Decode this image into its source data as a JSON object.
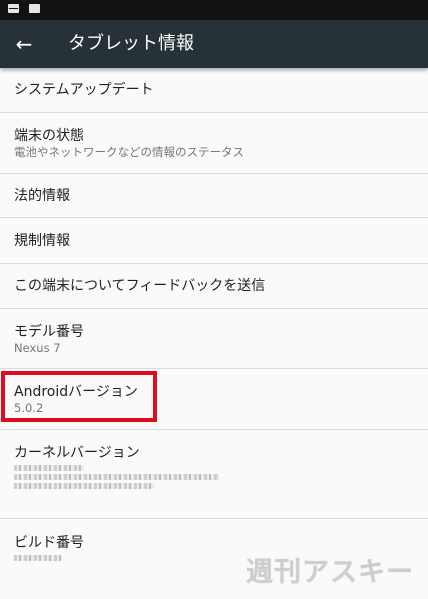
{
  "app_bar": {
    "title": "タブレット情報",
    "back_icon": "←"
  },
  "items": [
    {
      "title": "システムアップデート"
    },
    {
      "title": "端末の状態",
      "subtitle": "電池やネットワークなどの情報のステータス"
    },
    {
      "title": "法的情報"
    },
    {
      "title": "規制情報"
    },
    {
      "title": "この端末についてフィードバックを送信"
    },
    {
      "title": "モデル番号",
      "subtitle": "Nexus 7"
    },
    {
      "title": "Androidバージョン",
      "subtitle": "5.0.2"
    },
    {
      "title": "カーネルバージョン"
    },
    {
      "title": "ビルド番号"
    }
  ],
  "watermark": "週刊アスキー",
  "colors": {
    "status_bar": "#101214",
    "app_bar": "#263238",
    "background": "#fafafa",
    "highlight": "#e10b1f"
  }
}
